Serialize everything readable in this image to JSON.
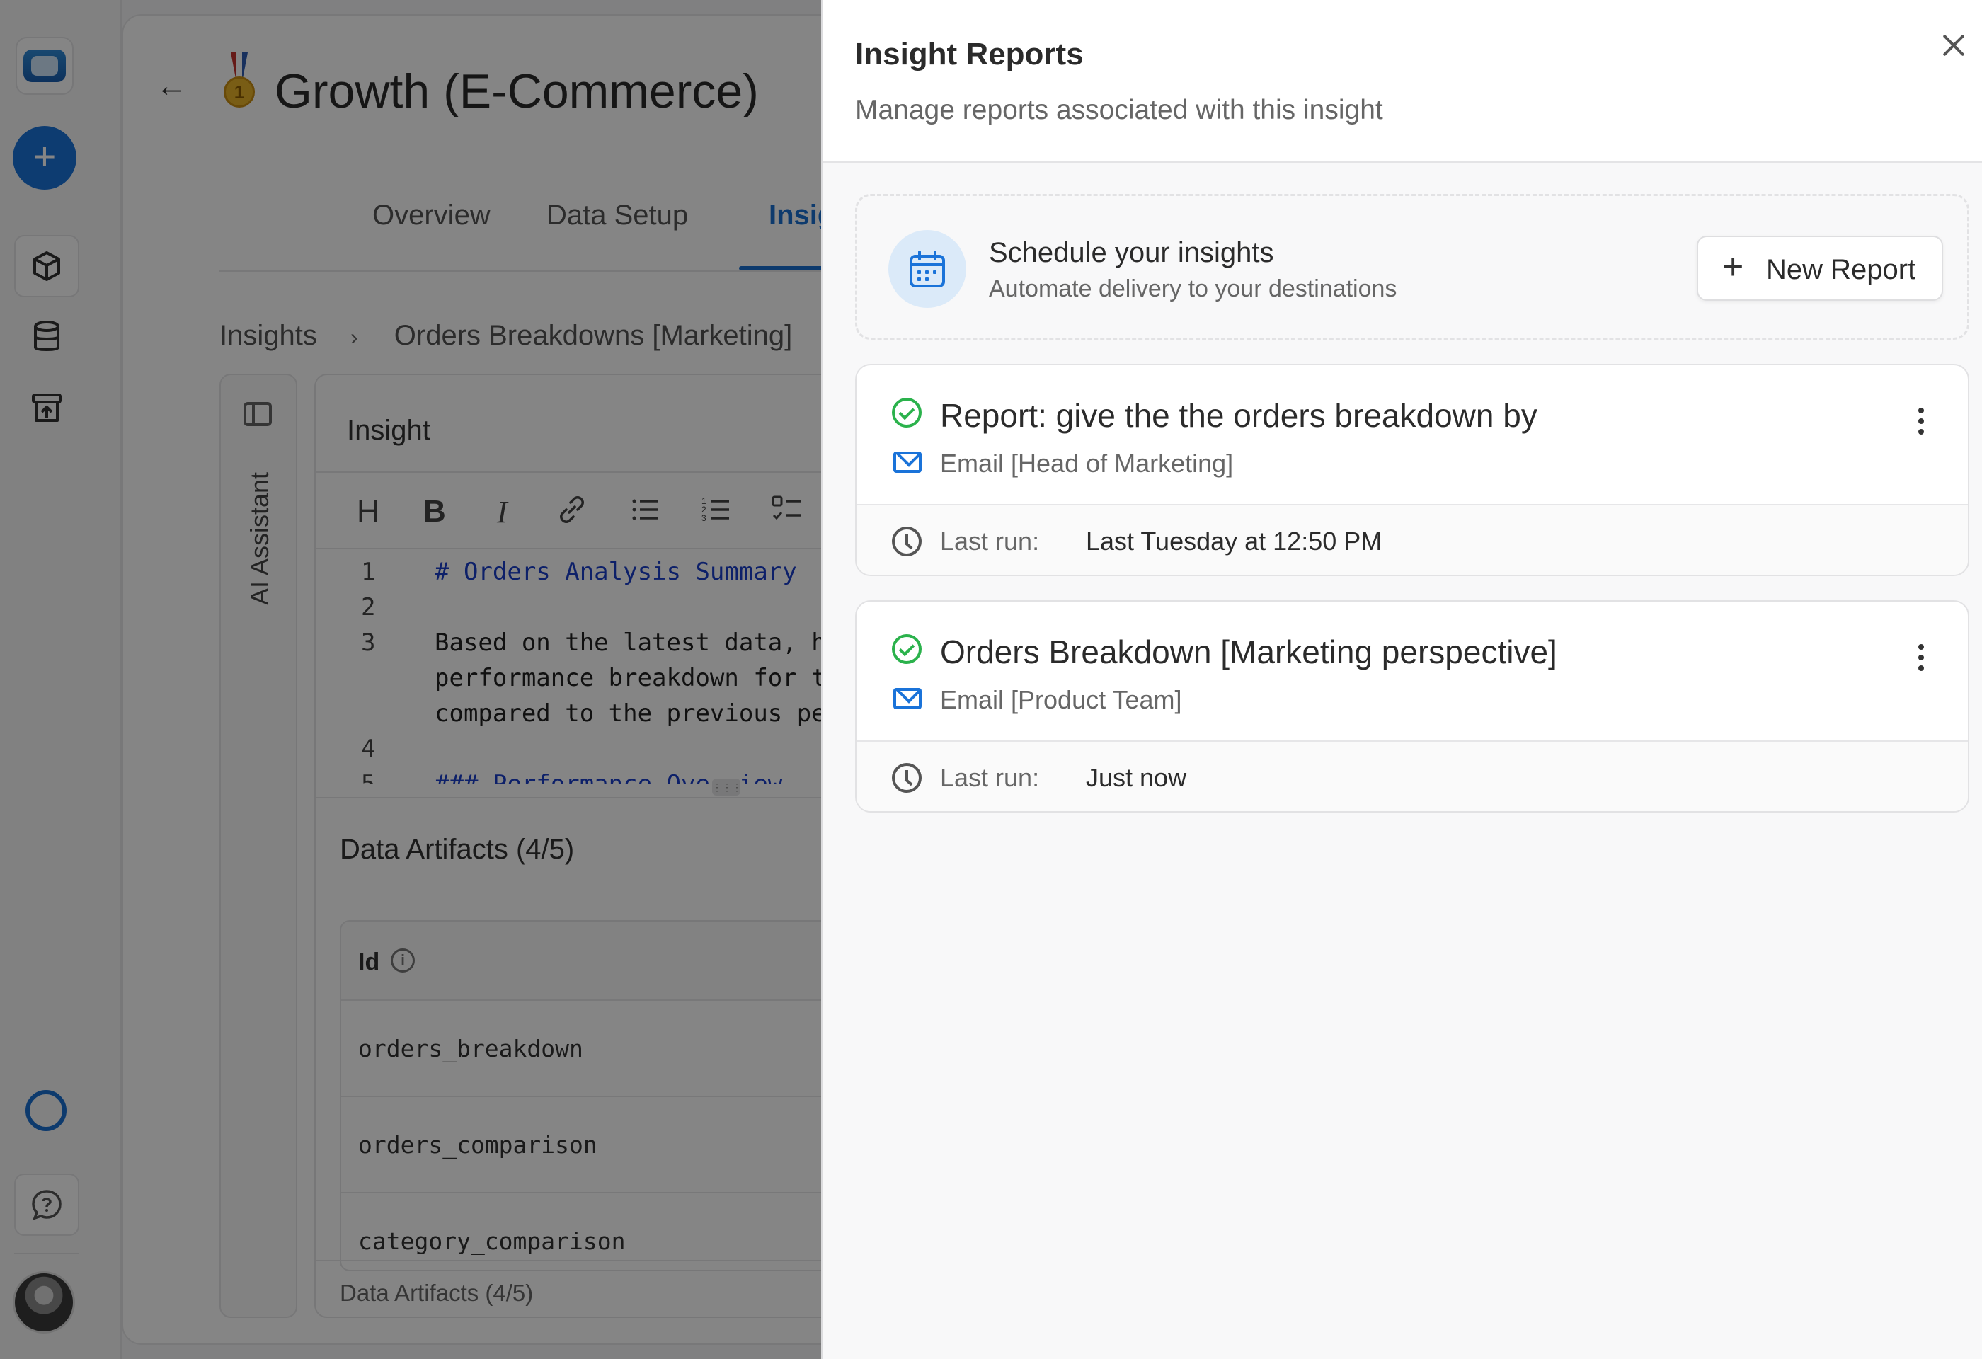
{
  "app": {
    "page_title": "Growth (E-Commerce)"
  },
  "tabs": [
    {
      "label": "Overview",
      "active": false
    },
    {
      "label": "Data Setup",
      "active": false
    },
    {
      "label": "Insights",
      "active": true
    }
  ],
  "breadcrumb": {
    "root": "Insights",
    "current": "Orders Breakdowns [Marketing]"
  },
  "ai_assistant": {
    "label": "AI Assistant"
  },
  "editor": {
    "title": "Insight",
    "toolbar": [
      "heading",
      "bold",
      "italic",
      "link",
      "bullet-list",
      "numbered-list",
      "task-list"
    ],
    "lines": [
      {
        "n": "1",
        "text": "# Orders Analysis Summary"
      },
      {
        "n": "2",
        "text": ""
      },
      {
        "n": "3",
        "text": "Based on the latest data, h"
      },
      {
        "n": "",
        "text": "performance breakdown for t"
      },
      {
        "n": "",
        "text": "compared to the previous pe"
      },
      {
        "n": "4",
        "text": ""
      },
      {
        "n": "5",
        "text": "### Performance Overview"
      }
    ]
  },
  "artifacts": {
    "title": "Data Artifacts (4/5)",
    "column_header": "Id",
    "rows": [
      "orders_breakdown",
      "orders_comparison",
      "category_comparison"
    ],
    "footer": "Data Artifacts (4/5)"
  },
  "drawer": {
    "title": "Insight Reports",
    "subtitle": "Manage reports associated with this insight",
    "schedule": {
      "title": "Schedule your insights",
      "subtitle": "Automate delivery to your destinations",
      "button": "New Report"
    },
    "last_run_label": "Last run:",
    "reports": [
      {
        "title": "Report: give the the orders breakdown by",
        "destination": "Email [Head of Marketing]",
        "last_run": "Last Tuesday at 12:50 PM",
        "status": "success"
      },
      {
        "title": "Orders Breakdown [Marketing perspective]",
        "destination": "Email [Product Team]",
        "last_run": "Just now",
        "status": "success"
      }
    ]
  },
  "colors": {
    "accent": "#1a6fd2",
    "success": "#2bb24c",
    "overlay": "rgba(0,0,0,0.48)"
  }
}
